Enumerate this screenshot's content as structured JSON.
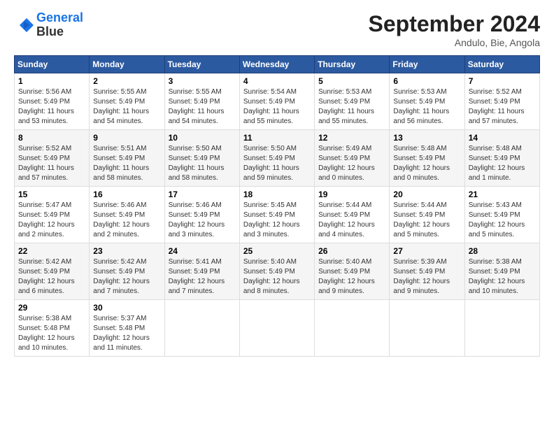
{
  "header": {
    "logo_line1": "General",
    "logo_line2": "Blue",
    "month": "September 2024",
    "location": "Andulo, Bie, Angola"
  },
  "weekdays": [
    "Sunday",
    "Monday",
    "Tuesday",
    "Wednesday",
    "Thursday",
    "Friday",
    "Saturday"
  ],
  "weeks": [
    [
      {
        "day": "1",
        "rise": "5:56 AM",
        "set": "5:49 PM",
        "hours": "11 hours and 53 minutes."
      },
      {
        "day": "2",
        "rise": "5:55 AM",
        "set": "5:49 PM",
        "hours": "11 hours and 54 minutes."
      },
      {
        "day": "3",
        "rise": "5:55 AM",
        "set": "5:49 PM",
        "hours": "11 hours and 54 minutes."
      },
      {
        "day": "4",
        "rise": "5:54 AM",
        "set": "5:49 PM",
        "hours": "11 hours and 55 minutes."
      },
      {
        "day": "5",
        "rise": "5:53 AM",
        "set": "5:49 PM",
        "hours": "11 hours and 55 minutes."
      },
      {
        "day": "6",
        "rise": "5:53 AM",
        "set": "5:49 PM",
        "hours": "11 hours and 56 minutes."
      },
      {
        "day": "7",
        "rise": "5:52 AM",
        "set": "5:49 PM",
        "hours": "11 hours and 57 minutes."
      }
    ],
    [
      {
        "day": "8",
        "rise": "5:52 AM",
        "set": "5:49 PM",
        "hours": "11 hours and 57 minutes."
      },
      {
        "day": "9",
        "rise": "5:51 AM",
        "set": "5:49 PM",
        "hours": "11 hours and 58 minutes."
      },
      {
        "day": "10",
        "rise": "5:50 AM",
        "set": "5:49 PM",
        "hours": "11 hours and 58 minutes."
      },
      {
        "day": "11",
        "rise": "5:50 AM",
        "set": "5:49 PM",
        "hours": "11 hours and 59 minutes."
      },
      {
        "day": "12",
        "rise": "5:49 AM",
        "set": "5:49 PM",
        "hours": "12 hours and 0 minutes."
      },
      {
        "day": "13",
        "rise": "5:48 AM",
        "set": "5:49 PM",
        "hours": "12 hours and 0 minutes."
      },
      {
        "day": "14",
        "rise": "5:48 AM",
        "set": "5:49 PM",
        "hours": "12 hours and 1 minute."
      }
    ],
    [
      {
        "day": "15",
        "rise": "5:47 AM",
        "set": "5:49 PM",
        "hours": "12 hours and 2 minutes."
      },
      {
        "day": "16",
        "rise": "5:46 AM",
        "set": "5:49 PM",
        "hours": "12 hours and 2 minutes."
      },
      {
        "day": "17",
        "rise": "5:46 AM",
        "set": "5:49 PM",
        "hours": "12 hours and 3 minutes."
      },
      {
        "day": "18",
        "rise": "5:45 AM",
        "set": "5:49 PM",
        "hours": "12 hours and 3 minutes."
      },
      {
        "day": "19",
        "rise": "5:44 AM",
        "set": "5:49 PM",
        "hours": "12 hours and 4 minutes."
      },
      {
        "day": "20",
        "rise": "5:44 AM",
        "set": "5:49 PM",
        "hours": "12 hours and 5 minutes."
      },
      {
        "day": "21",
        "rise": "5:43 AM",
        "set": "5:49 PM",
        "hours": "12 hours and 5 minutes."
      }
    ],
    [
      {
        "day": "22",
        "rise": "5:42 AM",
        "set": "5:49 PM",
        "hours": "12 hours and 6 minutes."
      },
      {
        "day": "23",
        "rise": "5:42 AM",
        "set": "5:49 PM",
        "hours": "12 hours and 7 minutes."
      },
      {
        "day": "24",
        "rise": "5:41 AM",
        "set": "5:49 PM",
        "hours": "12 hours and 7 minutes."
      },
      {
        "day": "25",
        "rise": "5:40 AM",
        "set": "5:49 PM",
        "hours": "12 hours and 8 minutes."
      },
      {
        "day": "26",
        "rise": "5:40 AM",
        "set": "5:49 PM",
        "hours": "12 hours and 9 minutes."
      },
      {
        "day": "27",
        "rise": "5:39 AM",
        "set": "5:49 PM",
        "hours": "12 hours and 9 minutes."
      },
      {
        "day": "28",
        "rise": "5:38 AM",
        "set": "5:49 PM",
        "hours": "12 hours and 10 minutes."
      }
    ],
    [
      {
        "day": "29",
        "rise": "5:38 AM",
        "set": "5:48 PM",
        "hours": "12 hours and 10 minutes."
      },
      {
        "day": "30",
        "rise": "5:37 AM",
        "set": "5:48 PM",
        "hours": "12 hours and 11 minutes."
      },
      null,
      null,
      null,
      null,
      null
    ]
  ]
}
